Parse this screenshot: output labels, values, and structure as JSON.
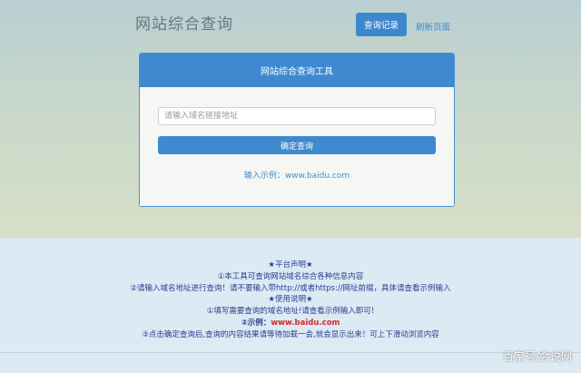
{
  "header": {
    "title": "网站综合查询",
    "history_button": "查询记录",
    "refresh_link": "刷新页面"
  },
  "panel": {
    "title": "网站综合查询工具",
    "input_placeholder": "请输入域名链接地址",
    "submit_label": "确定查询",
    "example_text": "输入示例：www.baidu.com"
  },
  "notice": {
    "platform_heading": "★平台声明★",
    "platform_1": "①本工具可查询网站域名综合各种信息内容",
    "platform_2": "②请输入域名地址进行查询！请不要输入带http://或者https://网址前缀，具体请查看示例输入",
    "usage_heading": "★使用说明★",
    "usage_1": "①填写需要查询的域名地址!请查看示例输入即可!",
    "usage_2_prefix": "②示例：",
    "usage_2_value": "www.baidu.com",
    "usage_3": "③点击确定查询后,查询的内容结果请等待加载一会,就会显示出来！可上下滑动浏览内容"
  },
  "watermark": "百家号/会说网",
  "colors": {
    "accent": "#3e89cf",
    "link": "#3d8fd0",
    "notice_text": "#2a3d8f",
    "highlight": "#d42a2a"
  }
}
